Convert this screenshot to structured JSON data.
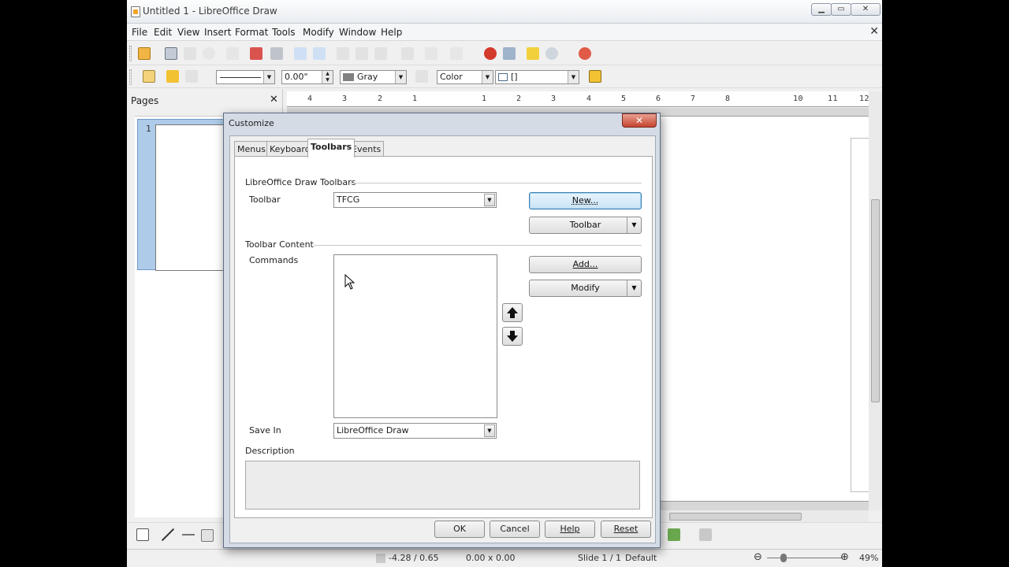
{
  "window": {
    "title": "Untitled 1 - LibreOffice Draw",
    "min_glyph": "▁",
    "max_glyph": "▭",
    "close_glyph": "✕"
  },
  "menu": {
    "items": [
      "File",
      "Edit",
      "View",
      "Insert",
      "Format",
      "Tools",
      "Modify",
      "Window",
      "Help"
    ],
    "close_glyph": "✕"
  },
  "line_toolbar": {
    "width_value": "0.00\"",
    "area_color": "Gray",
    "area_style": "Color",
    "area_fill": "[]",
    "gray_swatch": "#808080"
  },
  "pages_panel": {
    "title": "Pages",
    "close_glyph": "✕",
    "page_number": "1"
  },
  "ruler": {
    "ticks": [
      "4",
      "3",
      "2",
      "1",
      "1",
      "2",
      "3",
      "4",
      "5",
      "6",
      "7",
      "8",
      "10",
      "11",
      "12"
    ]
  },
  "statusbar": {
    "position": "-4.28 / 0.65",
    "size": "0.00 x 0.00",
    "slide": "Slide 1 / 1",
    "layout": "Default",
    "zoom": "49%",
    "zoom_minus": "⊖",
    "zoom_plus": "⊕"
  },
  "dialog": {
    "title": "Customize",
    "close_glyph": "✕",
    "tabs": [
      {
        "label": "Menus"
      },
      {
        "label": "Keyboard"
      },
      {
        "label": "Toolbars"
      },
      {
        "label": "Events"
      }
    ],
    "toolbars_section": "LibreOffice Draw Toolbars",
    "toolbar_label": "Toolbar",
    "toolbar_value": "TFCG",
    "new_button": "New...",
    "toolbar_button": "Toolbar",
    "content_section": "Toolbar Content",
    "commands_label": "Commands",
    "add_button": "Add...",
    "modify_button": "Modify",
    "up_glyph": "🡅",
    "down_glyph": "🡇",
    "save_in_label": "Save In",
    "save_in_value": "LibreOffice Draw",
    "description_label": "Description",
    "ok_button": "OK",
    "cancel_button": "Cancel",
    "help_button": "Help",
    "reset_button": "Reset"
  }
}
